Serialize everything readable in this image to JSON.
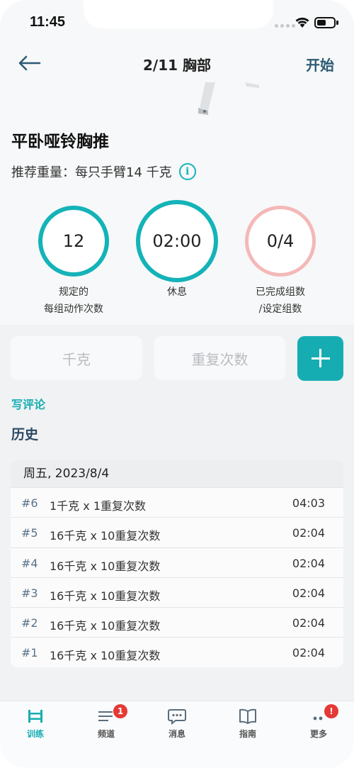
{
  "status_bar": {
    "time": "11:45"
  },
  "nav": {
    "title": "2/11 胸部",
    "start_label": "开始"
  },
  "exercise": {
    "name": "平卧哑铃胸推",
    "recommended_weight": "推荐重量：每只手臂14 千克"
  },
  "stats": [
    {
      "value": "12",
      "label_line1": "规定的",
      "label_line2": "每组动作次数",
      "ring_color": "#14b3b8"
    },
    {
      "value": "02:00",
      "label_line1": "休息",
      "label_line2": "",
      "ring_color": "#14b3b8"
    },
    {
      "value": "0/4",
      "label_line1": "已完成组数",
      "label_line2": "/设定组数",
      "ring_color": "#f4b8b8"
    }
  ],
  "inputs": {
    "weight_placeholder": "千克",
    "reps_placeholder": "重复次数"
  },
  "comment_label": "写评论",
  "history": {
    "title": "历史",
    "date": "周五, 2023/8/4",
    "rows": [
      {
        "num": "#6",
        "desc": "1千克 x 1重复次数",
        "time": "04:03"
      },
      {
        "num": "#5",
        "desc": "16千克 x 10重复次数",
        "time": "02:04"
      },
      {
        "num": "#4",
        "desc": "16千克 x 10重复次数",
        "time": "02:04"
      },
      {
        "num": "#3",
        "desc": "16千克 x 10重复次数",
        "time": "02:04"
      },
      {
        "num": "#2",
        "desc": "16千克 x 10重复次数",
        "time": "02:04"
      },
      {
        "num": "#1",
        "desc": "16千克 x 10重复次数",
        "time": "02:04"
      }
    ]
  },
  "tabs": [
    {
      "label": "训练",
      "icon": "dumbbell-icon",
      "badge": ""
    },
    {
      "label": "频道",
      "icon": "list-icon",
      "badge": "1"
    },
    {
      "label": "消息",
      "icon": "chat-icon",
      "badge": ""
    },
    {
      "label": "指南",
      "icon": "book-icon",
      "badge": ""
    },
    {
      "label": "更多",
      "icon": "more-icon",
      "badge": "!"
    }
  ],
  "colors": {
    "accent": "#16adb2",
    "nav_text": "#2b5a73",
    "badge": "#e53935"
  }
}
